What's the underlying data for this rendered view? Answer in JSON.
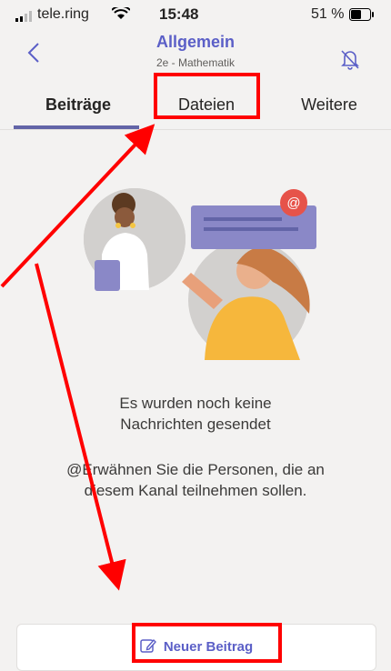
{
  "status_bar": {
    "carrier": "tele.ring",
    "time": "15:48",
    "battery": "51 %"
  },
  "header": {
    "title": "Allgemein",
    "subtitle": "2e - Mathematik"
  },
  "tabs": [
    {
      "label": "Beiträge",
      "active": true
    },
    {
      "label": "Dateien",
      "active": false
    },
    {
      "label": "Weitere",
      "active": false
    }
  ],
  "empty_state": {
    "line1": "Es wurden noch keine",
    "line2": "Nachrichten gesendet",
    "line3": "@Erwähnen Sie die Personen, die an",
    "line4": "diesem Kanal teilnehmen sollen."
  },
  "footer": {
    "new_post_label": "Neuer Beitrag"
  },
  "icons": [
    "signal-icon",
    "wifi-icon",
    "battery-icon",
    "back-chevron-icon",
    "bell-off-icon",
    "edit-icon"
  ],
  "colors": {
    "accent": "#5b5fc7",
    "annotation": "#ff0000",
    "background": "#f3f2f1"
  }
}
